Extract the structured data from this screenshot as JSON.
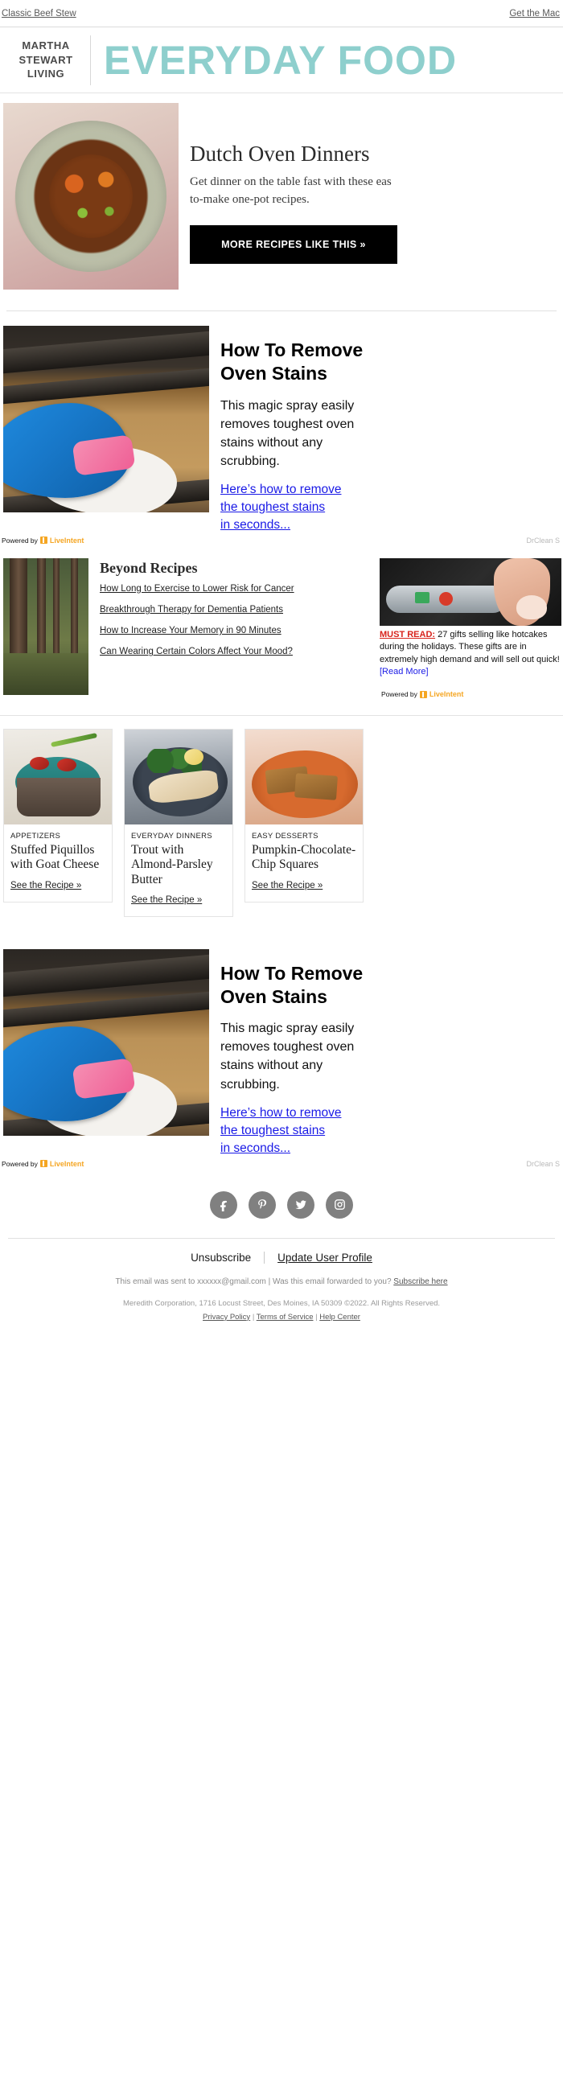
{
  "preheader": {
    "left_link": "Classic Beef Stew",
    "right_link": "Get the Mac"
  },
  "masthead": {
    "brand_line1": "MARTHA",
    "brand_line2": "STEWART",
    "brand_line3": "LIVING",
    "publication": "EVERYDAY FOOD",
    "brand_color": "#8ecfcd"
  },
  "hero": {
    "title": "Dutch Oven Dinners",
    "description_line1": "Get dinner on the table fast with these eas",
    "description_line2": "to-make one-pot recipes.",
    "cta_label": "MORE RECIPES LIKE THIS »",
    "cta_bg": "#000000"
  },
  "ad_top": {
    "headline_line1": "How To Remove",
    "headline_line2": "Oven Stains",
    "body_line1": "This magic spray easily",
    "body_line2": "removes toughest oven",
    "body_line3": "stains without any",
    "body_line4": "scrubbing.",
    "link_line1": "Here’s how to remove",
    "link_line2": "the toughest stains",
    "link_line3": "in seconds...",
    "powered_by_label": "Powered by",
    "powered_by_brand": "LiveIntent",
    "advertiser": "DrClean S",
    "link_color": "#1a1ae6",
    "brand_color": "#f5a623"
  },
  "beyond": {
    "title": "Beyond Recipes",
    "links": [
      "How Long to Exercise to Lower Risk for Cancer",
      "Breakthrough Therapy for Dementia Patients",
      "How to Increase Your Memory in 90 Minutes",
      "Can Wearing Certain Colors Affect Your Mood?"
    ]
  },
  "ad_side": {
    "must_read_label": "MUST READ:",
    "body": "27 gifts selling like hotcakes during the holidays. These gifts are in extremely high demand and will sell out quick!",
    "read_more": "[Read More]",
    "powered_by_label": "Powered by",
    "powered_by_brand": "LiveIntent",
    "must_read_color": "#d8231c"
  },
  "cards": [
    {
      "kicker": "APPETIZERS",
      "title": "Stuffed Piquillos with Goat Cheese",
      "link": "See the Recipe »"
    },
    {
      "kicker": "EVERYDAY DINNERS",
      "title": "Trout with Almond-Parsley Butter",
      "link": "See the Recipe »"
    },
    {
      "kicker": "EASY DESSERTS",
      "title": "Pumpkin-Chocolate-Chip Squares",
      "link": "See the Recipe »"
    }
  ],
  "ad_bottom": {
    "headline_line1": "How To Remove",
    "headline_line2": "Oven Stains",
    "body_line1": "This magic spray easily",
    "body_line2": "removes toughest oven",
    "body_line3": "stains without any",
    "body_line4": "scrubbing.",
    "link_line1": "Here’s how to remove",
    "link_line2": "the toughest stains",
    "link_line3": "in seconds...",
    "powered_by_label": "Powered by",
    "powered_by_brand": "LiveIntent",
    "advertiser": "DrClean S"
  },
  "social": {
    "items": [
      {
        "name": "facebook-icon",
        "label": "Facebook"
      },
      {
        "name": "pinterest-icon",
        "label": "Pinterest"
      },
      {
        "name": "twitter-icon",
        "label": "Twitter"
      },
      {
        "name": "instagram-icon",
        "label": "Instagram"
      }
    ],
    "bg_color": "#808080"
  },
  "footer": {
    "unsubscribe": "Unsubscribe",
    "update_profile": "Update User Profile",
    "sent_to": "This email was sent to xxxxxx@gmail.com",
    "pipe": "|",
    "forwarded": "Was this email forwarded to you?",
    "subscribe_here": "Subscribe here",
    "legal": "Meredith Corporation, 1716 Locust Street, Des Moines, IA 50309 ©2022. All Rights Reserved.",
    "privacy_policy": "Privacy Policy",
    "terms": "Terms of Service",
    "help_center": "Help Center",
    "sep": "|"
  }
}
